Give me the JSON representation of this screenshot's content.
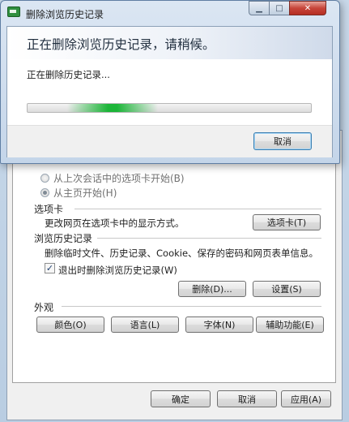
{
  "options": {
    "startup": {
      "radio_last_session": "从上次会话中的选项卡开始(B)",
      "radio_home": "从主页开始(H)",
      "selected": "radio_home"
    },
    "tabs_section": {
      "title": "选项卡",
      "description": "更改网页在选项卡中的显示方式。",
      "button": "选项卡(T)"
    },
    "history_section": {
      "title": "浏览历史记录",
      "description": "删除临时文件、历史记录、Cookie、保存的密码和网页表单信息。",
      "checkbox_label": "退出时删除浏览历史记录(W)",
      "checkbox_checked": true,
      "delete_button": "删除(D)...",
      "settings_button": "设置(S)"
    },
    "appearance_section": {
      "title": "外观",
      "buttons": [
        "颜色(O)",
        "语言(L)",
        "字体(N)",
        "辅助功能(E)"
      ]
    },
    "footer_buttons": {
      "ok": "确定",
      "cancel": "取消",
      "apply": "应用(A)"
    }
  },
  "dialog": {
    "title": "删除浏览历史记录",
    "header": "正在删除浏览历史记录，请稍候。",
    "status": "正在删除历史记录...",
    "progress_fraction": 0.3,
    "cancel_label": "取消",
    "window_controls": {
      "minimize_icon": "minimize-icon",
      "maximize_icon": "maximize-icon",
      "close_icon": "close-icon"
    }
  },
  "colors": {
    "progress_green": "#06b025",
    "title_bar": "#c4d5e9"
  }
}
